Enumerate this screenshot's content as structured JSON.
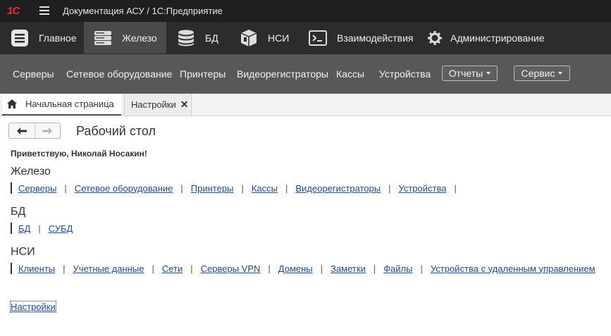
{
  "titlebar": {
    "logo": "1С",
    "title": "Документация АСУ / 1С:Предприятие"
  },
  "main_nav": [
    {
      "label": "Главное",
      "icon": "menu-list-icon",
      "active": false
    },
    {
      "label": "Железо",
      "icon": "server-icon",
      "active": true
    },
    {
      "label": "БД",
      "icon": "database-icon",
      "active": false
    },
    {
      "label": "НСИ",
      "icon": "reference-box-icon",
      "active": false
    },
    {
      "label": "Взаимодействия",
      "icon": "terminal-icon",
      "active": false
    },
    {
      "label": "Администрирование",
      "icon": "gear-icon",
      "active": false
    }
  ],
  "sub_nav": {
    "items": [
      "Серверы",
      "Сетевое оборудование",
      "Принтеры",
      "Видеорегистраторы",
      "Кассы",
      "Устройства"
    ],
    "reports": "Отчеты",
    "service": "Сервис"
  },
  "tabs": {
    "home": "Начальная страница",
    "settings": "Настройки"
  },
  "page": {
    "title": "Рабочий стол",
    "greeting": "Приветствую, Николай Носакин!",
    "sections": [
      {
        "title": "Железо",
        "links": [
          "Серверы",
          "Сетевое оборудование",
          "Принтеры",
          "Кассы",
          "Видеорегистраторы",
          "Устройства"
        ],
        "trailing_sep": true
      },
      {
        "title": "БД",
        "links": [
          "БД",
          "СУБД"
        ],
        "trailing_sep": false
      },
      {
        "title": "НСИ",
        "links": [
          "Клиенты",
          "Учетные данные",
          "Сети",
          "Серверы VPN",
          "Домены",
          "Заметки",
          "Файлы",
          "Устройства с удаленным управлением"
        ],
        "trailing_sep": false
      }
    ],
    "settings_link": "Настройки"
  },
  "colors": {
    "link": "#1c4a9c",
    "logo": "#e8302a",
    "topbar": "#1f1f1f",
    "mainnav": "#2c2c2c",
    "subnav": "#585858"
  }
}
